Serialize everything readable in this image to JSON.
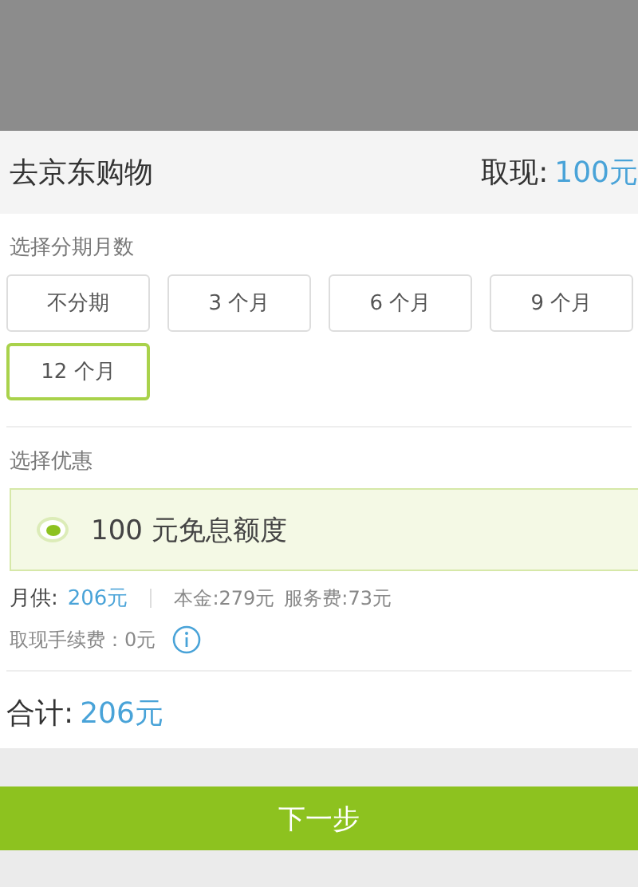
{
  "header": {
    "title": "去京东购物",
    "cash_label": "取现:",
    "cash_amount": "100元"
  },
  "installments": {
    "label": "选择分期月数",
    "options": [
      {
        "label": "不分期",
        "selected": false
      },
      {
        "label": "3 个月",
        "selected": false
      },
      {
        "label": "6 个月",
        "selected": false
      },
      {
        "label": "9 个月",
        "selected": false
      },
      {
        "label": "12 个月",
        "selected": true
      }
    ]
  },
  "discount": {
    "label": "选择优惠",
    "option": {
      "label": "100 元免息额度",
      "selected": true
    }
  },
  "summary": {
    "monthly_label": "月供:",
    "monthly_amount": "206元",
    "principal": "本金:279元",
    "service_fee": "服务费:73元",
    "cash_fee": "取现手续费：0元"
  },
  "total": {
    "label": "合计:",
    "amount": "206元"
  },
  "next_button": "下一步"
}
